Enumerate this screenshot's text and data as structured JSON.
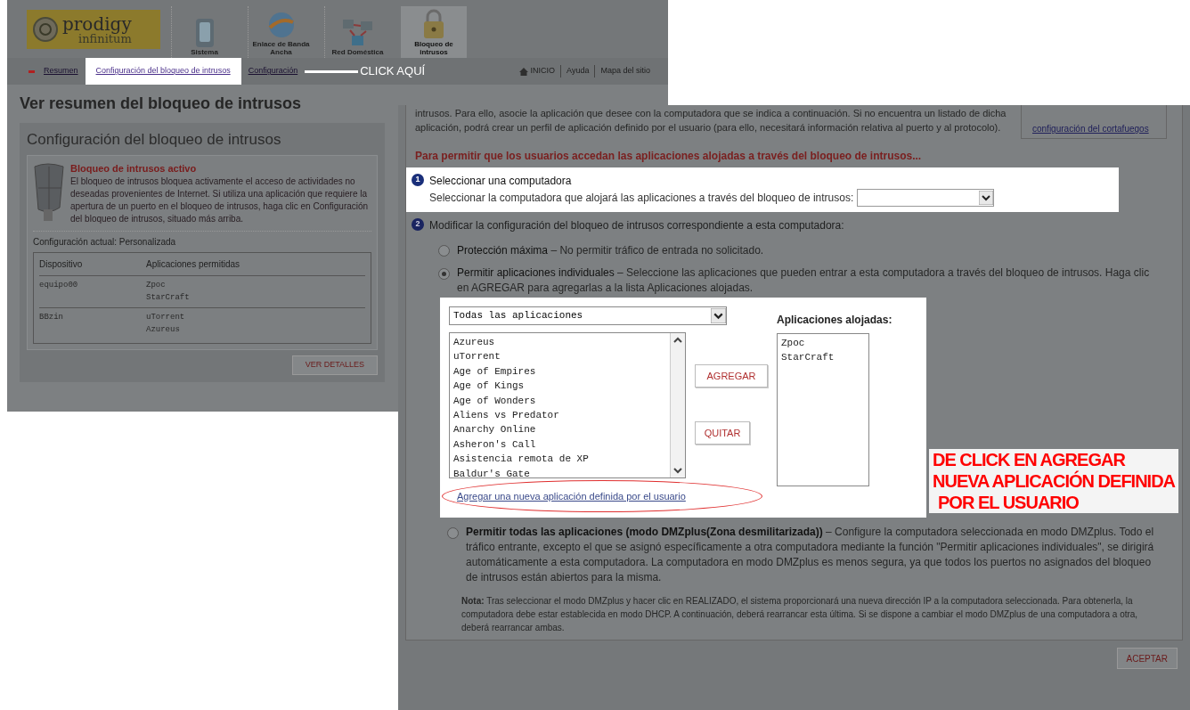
{
  "left_screen": {
    "logo": {
      "brand": "prodigy",
      "sub": "infinitum"
    },
    "nav_tabs": [
      {
        "label": "Sistema",
        "selected": false
      },
      {
        "label": "Enlace de Banda Ancha",
        "selected": false
      },
      {
        "label": "Red Doméstica",
        "selected": false
      },
      {
        "label": "Bloqueo de intrusos",
        "selected": true
      }
    ],
    "sub_nav": [
      {
        "label": "Resumen",
        "highlighted": false
      },
      {
        "label": "Configuración del bloqueo de intrusos",
        "highlighted": true
      },
      {
        "label": "Configuración",
        "highlighted": false
      }
    ],
    "callout": "CLICK AQUÍ",
    "top_links": [
      "INICIO",
      "Ayuda",
      "Mapa del sitio"
    ],
    "page_title": "Ver resumen del bloqueo de intrusos",
    "card_title": "Configuración del bloqueo de intrusos",
    "status_title": "Bloqueo de intrusos activo",
    "status_text": "El bloqueo de intrusos bloquea activamente el acceso de actividades no deseadas provenientes de Internet. Si utiliza una aplicación que requiere la apertura de un puerto en el bloqueo de intrusos, haga clic en Configuración del bloqueo de intrusos, situado más arriba.",
    "current_config": "Configuración actual: Personalizada",
    "table": {
      "columns": [
        "Dispositivo",
        "Aplicaciones permitidas"
      ],
      "rows": [
        {
          "device": "equipo00",
          "apps": [
            "Zpoc",
            "StarCraft"
          ]
        },
        {
          "device": "BBzin",
          "apps": [
            "uTorrent",
            "Azureus"
          ]
        }
      ]
    },
    "button": "VER DETALLES"
  },
  "right_screen": {
    "intro": "intrusos. Para ello, asocie la aplicación que desee con la computadora que se indica a continuación. Si no encuentra un listado de dicha aplicación, podrá crear un perfil de aplicación definido por el usuario (para ello, necesitará información relativa al puerto y al protocolo).",
    "side_link": "configuración del cortafuegos",
    "heading": "Para permitir que los usuarios accedan las aplicaciones alojadas a través del bloqueo de intrusos...",
    "step1": {
      "number": "1",
      "title": "Seleccionar una computadora",
      "label": "Seleccionar la computadora que alojará las aplicaciones a través del bloqueo de intrusos:"
    },
    "step2": {
      "number": "2",
      "title": "Modificar la configuración del bloqueo de intrusos correspondiente a esta computadora:"
    },
    "options": [
      {
        "title": "Protección máxima",
        "text": "– No permitir tráfico de entrada no solicitado.",
        "selected": false
      },
      {
        "title": "Permitir aplicaciones individuales",
        "text": "– Seleccione las aplicaciones que pueden entrar a esta computadora a través del bloqueo de intrusos. Haga clic en AGREGAR para agregarlas a la lista Aplicaciones alojadas.",
        "selected": true
      },
      {
        "title": "Permitir todas las aplicaciones (modo DMZplus(Zona desmilitarizada))",
        "text": "– Configure la computadora seleccionada en modo DMZplus. Todo el tráfico entrante, excepto el que se asignó específicamente a otra computadora mediante la función \"Permitir aplicaciones individuales\", se dirigirá automáticamente a esta computadora. La computadora en modo DMZplus es menos segura, ya que todos los puertos no asignados del bloqueo de intrusos están abiertos para la misma.",
        "selected": false
      }
    ],
    "filter": "Todas las aplicaciones",
    "apps": [
      "Azureus",
      "uTorrent",
      "Age of Empires",
      "Age of Kings",
      "Age of Wonders",
      "Aliens vs Predator",
      "Anarchy Online",
      "Asheron's Call",
      "Asistencia remota de XP",
      "Baldur's Gate"
    ],
    "add_button": "AGREGAR",
    "remove_button": "QUITAR",
    "hosted_label": "Aplicaciones alojadas:",
    "hosted": [
      "Zpoc",
      "StarCraft"
    ],
    "new_app_link": "Agregar una nueva aplicación definida por el usuario",
    "annotation": [
      "DE CLICK EN AGREGAR",
      "NUEVA APLICACIÓN DEFINIDA",
      "POR EL USUARIO"
    ],
    "note_label": "Nota:",
    "note": "Tras seleccionar el modo DMZplus y hacer clic en REALIZADO, el sistema proporcionará una nueva dirección IP a la computadora seleccionada. Para obtenerla, la computadora debe estar establecida en modo DHCP. A continuación, deberá rearrancar esta última. Si se dispone a cambiar el modo DMZplus de una computadora a otra, deberá rearrancar ambas.",
    "accept_button": "ACEPTAR"
  }
}
